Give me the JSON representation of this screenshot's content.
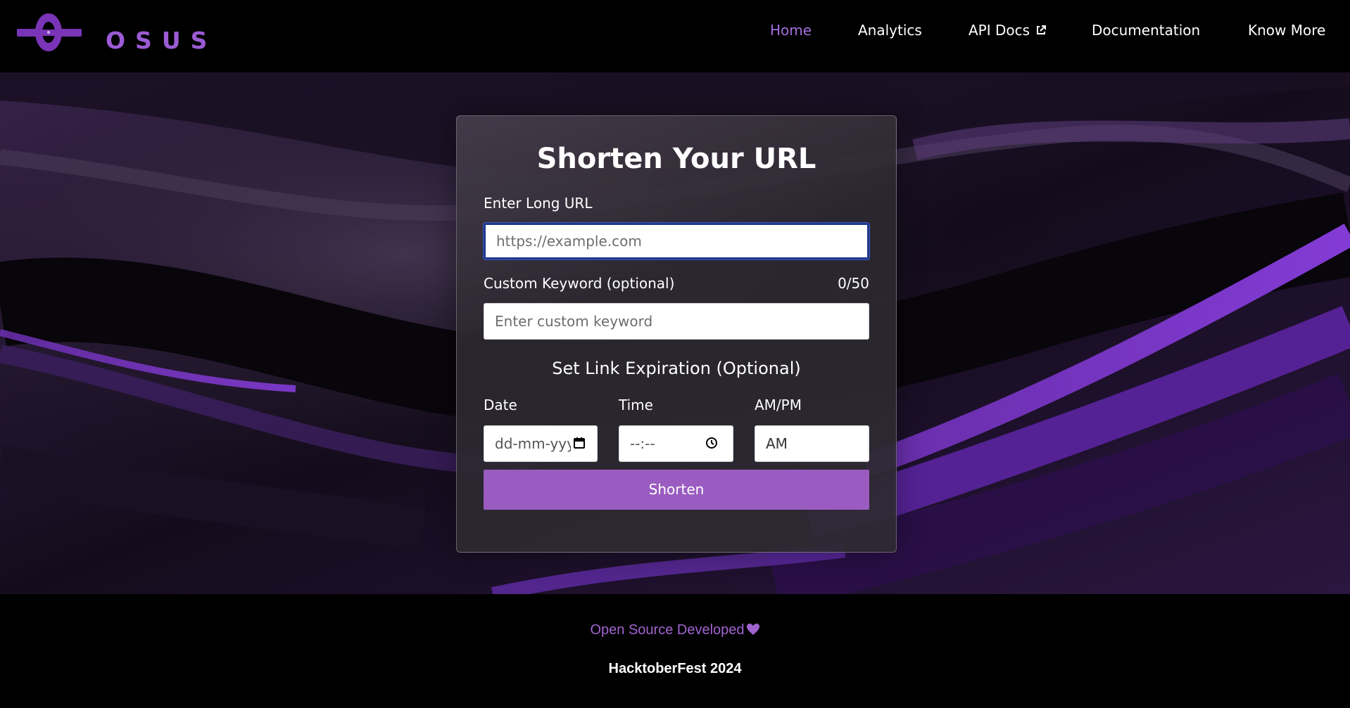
{
  "brand": {
    "name": "OSUS",
    "logo_text": "O S U S",
    "logo_color": "#9b5bd4"
  },
  "nav": {
    "items": [
      {
        "label": "Home",
        "active": true
      },
      {
        "label": "Analytics",
        "active": false
      },
      {
        "label": "API Docs",
        "active": false,
        "icon": "external-link-icon"
      },
      {
        "label": "Documentation",
        "active": false
      },
      {
        "label": "Know More",
        "active": false
      }
    ]
  },
  "form": {
    "title": "Shorten Your URL",
    "long_url": {
      "label": "Enter Long URL",
      "placeholder": "https://example.com",
      "value": ""
    },
    "keyword": {
      "label": "Custom Keyword (optional)",
      "placeholder": "Enter custom keyword",
      "value": "",
      "counter": "0/50"
    },
    "expiration": {
      "heading": "Set Link Expiration (Optional)",
      "date": {
        "label": "Date",
        "value": "dd-mm-yyyy",
        "icon": "calendar-icon"
      },
      "time": {
        "label": "Time",
        "value": "--:--",
        "icon": "clock-icon"
      },
      "ampm": {
        "label": "AM/PM",
        "value": "AM"
      }
    },
    "submit_label": "Shorten",
    "accent": "#9a5cc0"
  },
  "footer": {
    "line1": "Open Source Developed",
    "heart_icon": "heart-icon",
    "line2": "HacktoberFest 2024"
  }
}
